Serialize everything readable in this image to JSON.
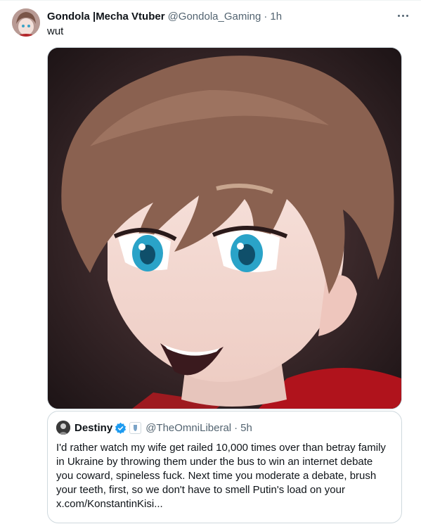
{
  "tweet": {
    "author_name": "Gondola |Mecha Vtuber",
    "handle": "@Gondola_Gaming",
    "separator": "·",
    "time": "1h",
    "text": "wut",
    "more_icon": "more-horizontal-icon"
  },
  "quote": {
    "author_name": "Destiny",
    "handle": "@TheOmniLiberal",
    "separator": "·",
    "time": "5h",
    "verified_color": "#1d9bf0",
    "lines": [
      "I'd rather watch my wife get railed 10,000 times over than betray family",
      "in Ukraine by throwing them under the bus to win an internet debate",
      "you coward, spineless fuck. Next time you moderate a debate, brush",
      "your teeth, first, so we don't have to smell Putin's load on your",
      "x.com/KonstantinKisi..."
    ]
  }
}
